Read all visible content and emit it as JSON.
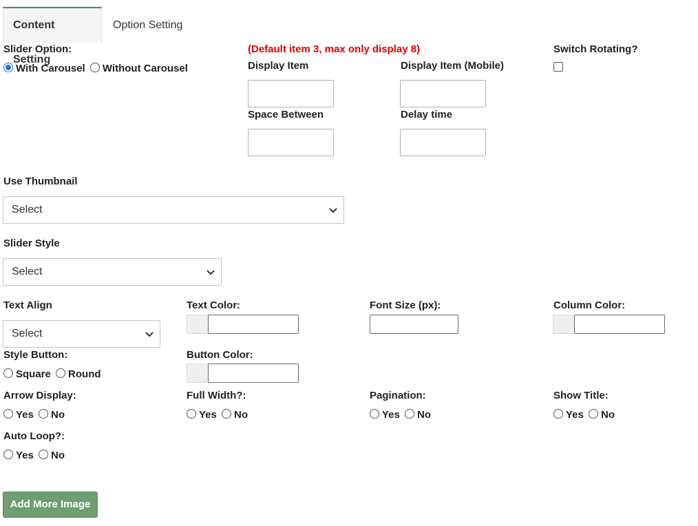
{
  "tabs": [
    {
      "label": "Content Setting",
      "active": true
    },
    {
      "label": "Option Setting",
      "active": false
    }
  ],
  "slider_option": {
    "label": "Slider Option:",
    "options": [
      "With Carousel",
      "Without Carousel"
    ],
    "selected": "With Carousel"
  },
  "note": "(Default item 3, max only display 8)",
  "display_item": {
    "label": "Display Item",
    "value": ""
  },
  "display_item_mobile": {
    "label": "Display Item (Mobile)",
    "value": ""
  },
  "space_between": {
    "label": "Space Between",
    "value": ""
  },
  "delay_time": {
    "label": "Delay time",
    "value": ""
  },
  "switch_rotating": {
    "label": "Switch Rotating?",
    "checked": false
  },
  "use_thumbnail": {
    "label": "Use Thumbnail",
    "value": "Select"
  },
  "slider_style": {
    "label": "Slider Style",
    "value": "Select"
  },
  "text_align": {
    "label": "Text Align",
    "value": "Select"
  },
  "text_color": {
    "label": "Text Color:",
    "value": ""
  },
  "font_size": {
    "label": "Font Size (px):",
    "value": ""
  },
  "column_color": {
    "label": "Column Color:",
    "value": ""
  },
  "style_button": {
    "label": "Style Button:",
    "options": [
      "Square",
      "Round"
    ]
  },
  "button_color": {
    "label": "Button Color:",
    "value": ""
  },
  "arrow_display": {
    "label": "Arrow Display:",
    "options": [
      "Yes",
      "No"
    ]
  },
  "full_width": {
    "label": "Full Width?:",
    "options": [
      "Yes",
      "No"
    ]
  },
  "pagination": {
    "label": "Pagination:",
    "options": [
      "Yes",
      "No"
    ]
  },
  "show_title": {
    "label": "Show Title:",
    "options": [
      "Yes",
      "No"
    ]
  },
  "auto_loop": {
    "label": "Auto Loop?:",
    "options": [
      "Yes",
      "No"
    ]
  },
  "add_more_image": {
    "label": "Add More Image"
  },
  "colors": {
    "accent": "#1a73e8",
    "note": "#e00000",
    "button": "#6f9e70",
    "tab_border": "#4a7e92"
  },
  "icons": {
    "dropdown": "chevron-down-icon",
    "radio": "radio-icon",
    "checkbox": "checkbox-icon"
  }
}
